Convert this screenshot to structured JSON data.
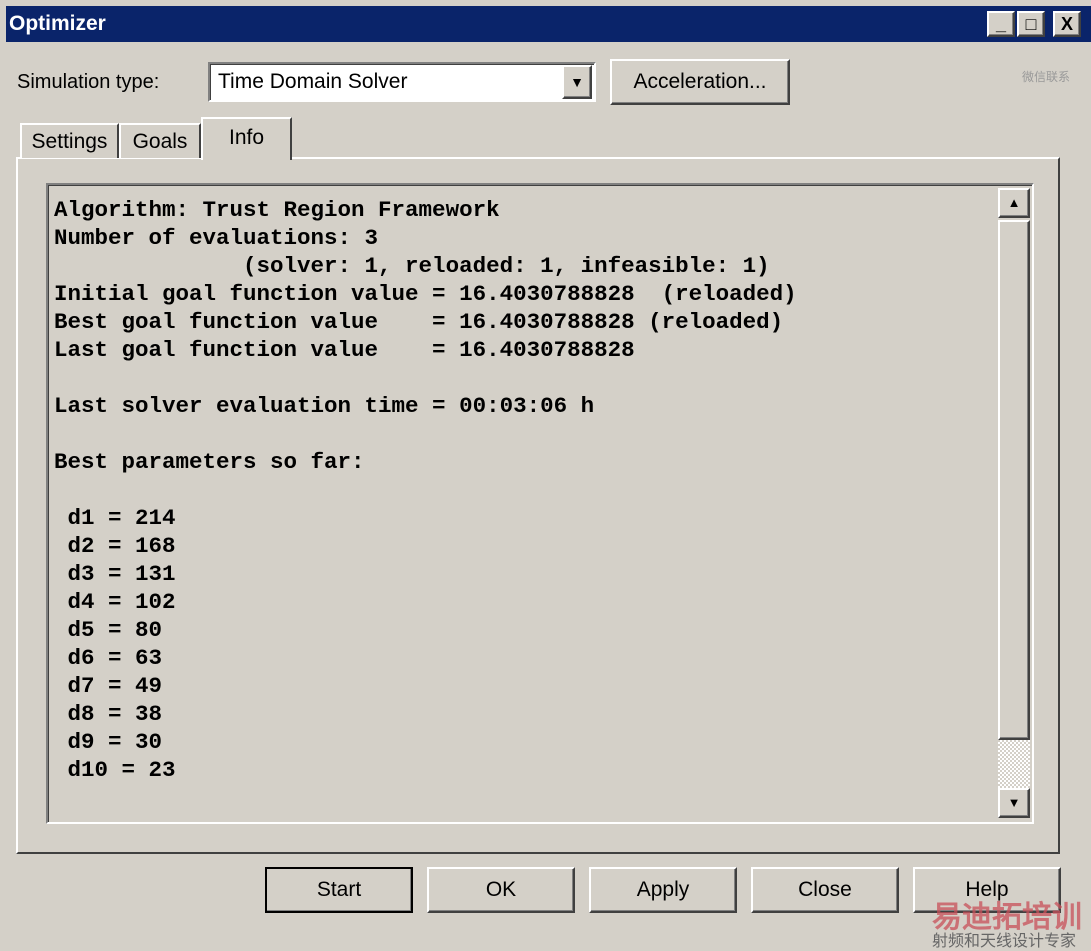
{
  "window": {
    "title": "Optimizer",
    "minimize": "_",
    "maximize": "□",
    "close": "X"
  },
  "simulation": {
    "label": "Simulation type:",
    "value": "Time Domain Solver",
    "acceleration_button": "Acceleration..."
  },
  "tabs": [
    {
      "label": "Settings"
    },
    {
      "label": "Goals"
    },
    {
      "label": "Info",
      "active": true
    }
  ],
  "info_lines": [
    "Algorithm: Trust Region Framework",
    "Number of evaluations: 3",
    "              (solver: 1, reloaded: 1, infeasible: 1)",
    "Initial goal function value = 16.4030788828  (reloaded)",
    "Best goal function value    = 16.4030788828 (reloaded)",
    "Last goal function value    = 16.4030788828",
    "",
    "Last solver evaluation time = 00:03:06 h",
    "",
    "Best parameters so far:",
    "",
    " d1 = 214",
    " d2 = 168",
    " d3 = 131",
    " d4 = 102",
    " d5 = 80",
    " d6 = 63",
    " d7 = 49",
    " d8 = 38",
    " d9 = 30",
    " d10 = 23"
  ],
  "buttons": {
    "start": "Start",
    "ok": "OK",
    "apply": "Apply",
    "close": "Close",
    "help": "Help"
  },
  "watermark": {
    "brand": "易迪拓培训",
    "subtitle": "射频和天线设计专家",
    "qr_caption": "微信联系"
  }
}
